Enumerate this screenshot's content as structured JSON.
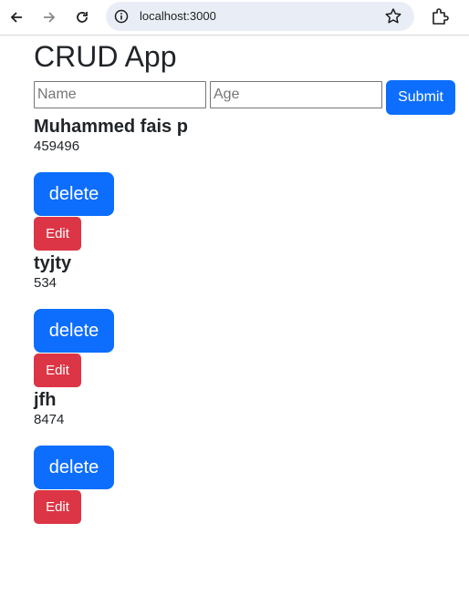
{
  "browser": {
    "url": "localhost:3000",
    "icons": [
      "back-arrow-icon",
      "forward-arrow-icon",
      "reload-icon",
      "site-info-icon",
      "bookmark-star-icon",
      "extensions-icon"
    ]
  },
  "page": {
    "title": "CRUD App"
  },
  "form": {
    "name_placeholder": "Name",
    "age_placeholder": "Age",
    "submit_label": "Submit"
  },
  "records": [
    {
      "name": "Muhammed fais p",
      "age": "459496",
      "delete_label": "delete",
      "edit_label": "Edit"
    },
    {
      "name": "tyjty",
      "age": "534",
      "delete_label": "delete",
      "edit_label": "Edit"
    },
    {
      "name": "jfh",
      "age": "8474",
      "delete_label": "delete",
      "edit_label": "Edit"
    }
  ],
  "colors": {
    "primary": "#0d6efd",
    "danger": "#dc3545",
    "text": "#212529",
    "omnibox": "#e9eef6"
  }
}
